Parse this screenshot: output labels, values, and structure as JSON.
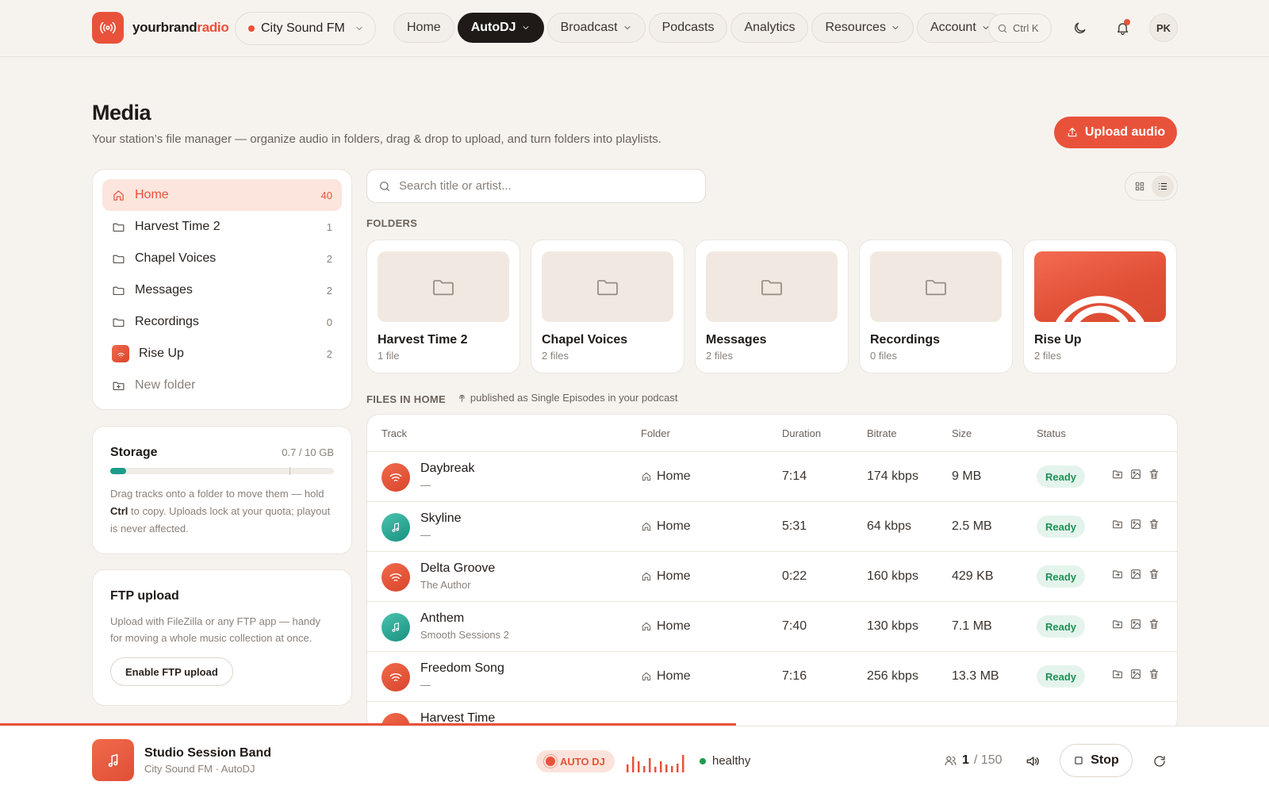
{
  "brand": {
    "name_dark": "yourbrand",
    "name_accent": "radio",
    "accent_color": "#e9523a"
  },
  "station": {
    "name": "City Sound FM"
  },
  "nav": {
    "items": [
      {
        "label": "Home",
        "active": false,
        "dropdown": false
      },
      {
        "label": "AutoDJ",
        "active": true,
        "dropdown": true
      },
      {
        "label": "Broadcast",
        "active": false,
        "dropdown": true
      },
      {
        "label": "Podcasts",
        "active": false,
        "dropdown": false
      },
      {
        "label": "Analytics",
        "active": false,
        "dropdown": false
      },
      {
        "label": "Resources",
        "active": false,
        "dropdown": true
      },
      {
        "label": "Account",
        "active": false,
        "dropdown": true
      }
    ],
    "search_shortcut": "Ctrl K",
    "user_initials": "PK"
  },
  "page": {
    "title": "Media",
    "subtitle": "Your station’s file manager — organize audio in folders, drag & drop to upload, and turn folders into playlists.",
    "upload_label": "Upload audio"
  },
  "sidebar": {
    "folders": [
      {
        "label": "Home",
        "count": "40",
        "icon": "home-icon",
        "active": true
      },
      {
        "label": "Harvest Time 2",
        "count": "1",
        "icon": "folder-icon"
      },
      {
        "label": "Chapel Voices",
        "count": "2",
        "icon": "folder-icon"
      },
      {
        "label": "Messages",
        "count": "2",
        "icon": "folder-icon"
      },
      {
        "label": "Recordings",
        "count": "0",
        "icon": "folder-icon"
      },
      {
        "label": "Rise Up",
        "count": "2",
        "icon": "cover-icon"
      }
    ],
    "new_folder_label": "New folder",
    "storage": {
      "title": "Storage",
      "value": "0.7 / 10 GB",
      "fraction": 0.07,
      "note_before": "Drag tracks onto a folder to move them — hold ",
      "note_key": "Ctrl",
      "note_after": " to copy. Uploads lock at your quota; playout is never affected."
    },
    "ftp": {
      "title": "FTP upload",
      "note": "Upload with FileZilla or any FTP app — handy for moving a whole music collection at once.",
      "button": "Enable FTP upload"
    }
  },
  "search": {
    "placeholder": "Search title or artist..."
  },
  "folders_section": {
    "label": "FOLDERS",
    "cards": [
      {
        "name": "Harvest Time 2",
        "count": "1 file",
        "cover": false
      },
      {
        "name": "Chapel Voices",
        "count": "2 files",
        "cover": false
      },
      {
        "name": "Messages",
        "count": "2 files",
        "cover": false
      },
      {
        "name": "Recordings",
        "count": "0 files",
        "cover": false
      },
      {
        "name": "Rise Up",
        "count": "2 files",
        "cover": true
      }
    ]
  },
  "files_section": {
    "label": "FILES IN HOME",
    "note": "published as Single Episodes in your podcast",
    "columns": [
      "Track",
      "Folder",
      "Duration",
      "Bitrate",
      "Size",
      "Status"
    ],
    "rows": [
      {
        "title": "Daybreak",
        "artist": "—",
        "folder": "Home",
        "duration": "7:14",
        "bitrate": "174 kbps",
        "size": "9 MB",
        "status": "Ready",
        "art": "orange"
      },
      {
        "title": "Skyline",
        "artist": "—",
        "folder": "Home",
        "duration": "5:31",
        "bitrate": "64 kbps",
        "size": "2.5 MB",
        "status": "Ready",
        "art": "teal"
      },
      {
        "title": "Delta Groove",
        "artist": "The Author",
        "folder": "Home",
        "duration": "0:22",
        "bitrate": "160 kbps",
        "size": "429 KB",
        "status": "Ready",
        "art": "orange"
      },
      {
        "title": "Anthem",
        "artist": "Smooth Sessions 2",
        "folder": "Home",
        "duration": "7:40",
        "bitrate": "130 kbps",
        "size": "7.1 MB",
        "status": "Ready",
        "art": "teal"
      },
      {
        "title": "Freedom Song",
        "artist": "—",
        "folder": "Home",
        "duration": "7:16",
        "bitrate": "256 kbps",
        "size": "13.3 MB",
        "status": "Ready",
        "art": "orange"
      },
      {
        "title": "Harvest Time",
        "artist": "",
        "folder": "",
        "duration": "",
        "bitrate": "",
        "size": "",
        "status": "",
        "art": "orange"
      }
    ]
  },
  "player": {
    "track": "Studio Session Band",
    "meta": "City Sound FM · AutoDJ",
    "mode": "AUTO DJ",
    "health": "healthy",
    "listeners_current": "1",
    "listeners_max": "/ 150",
    "stop_label": "Stop",
    "progress_fraction": 0.58
  }
}
